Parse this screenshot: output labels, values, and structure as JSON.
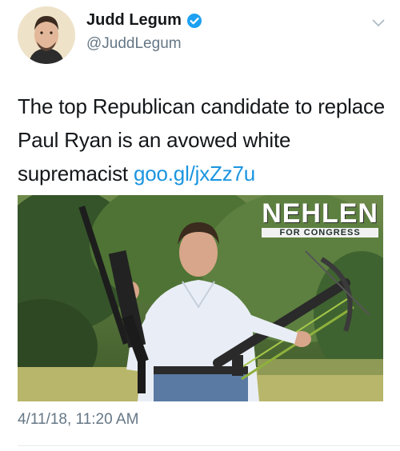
{
  "author": {
    "display_name": "Judd Legum",
    "handle": "@JuddLegum",
    "verified_icon": "verified-badge-icon"
  },
  "tweet": {
    "text": "The top Republican candidate to replace Paul Ryan is an avowed white supremacist",
    "link_text": "goo.gl/jxZz7u",
    "timestamp": "4/11/18, 11:20 AM"
  },
  "media": {
    "watermark_main": "NEHLEN",
    "watermark_sub": "FOR CONGRESS",
    "description_icon": "photo"
  },
  "colors": {
    "link": "#1b95e0",
    "verified": "#1da1f2",
    "secondary_text": "#657786"
  }
}
